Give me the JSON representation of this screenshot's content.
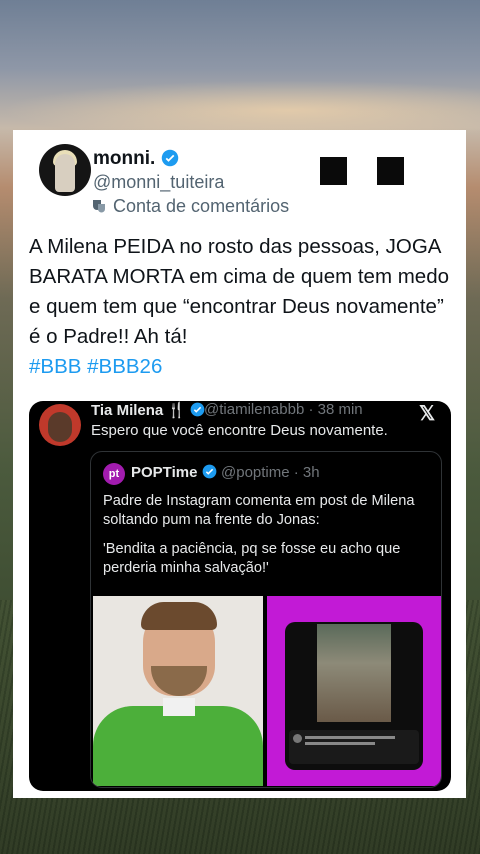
{
  "tweet": {
    "display_name": "monni.",
    "handle": "@monni_tuiteira",
    "account_label": "Conta de comentários",
    "text": "A Milena PEIDA no rosto das pessoas, JOGA BARATA MORTA em cima de quem tem medo e quem tem que “encontrar Deus  novamente” é o Padre!! Ah tá!",
    "hashtags": "#BBB #BBB26"
  },
  "quoted": {
    "display_name": "Tia Milena",
    "handle_time": "@tiamilenabbb · 38 min",
    "text": "Espero que você encontre Deus novamente.",
    "x_logo": "𝕏"
  },
  "inner_quote": {
    "logo_text": "pt",
    "display_name": "POPTime",
    "handle_time": "@poptime · 3h",
    "text_line1": "Padre de Instagram comenta em post de Milena soltando pum na frente do Jonas:",
    "text_line2": "'Bendita a paciência, pq se fosse eu acho que perderia minha salvação!'"
  },
  "colors": {
    "verified": "#1d9bf0",
    "hashtag": "#1d9bf0",
    "quote_bg": "#000000",
    "photo_right_bg": "#c21ad6"
  }
}
